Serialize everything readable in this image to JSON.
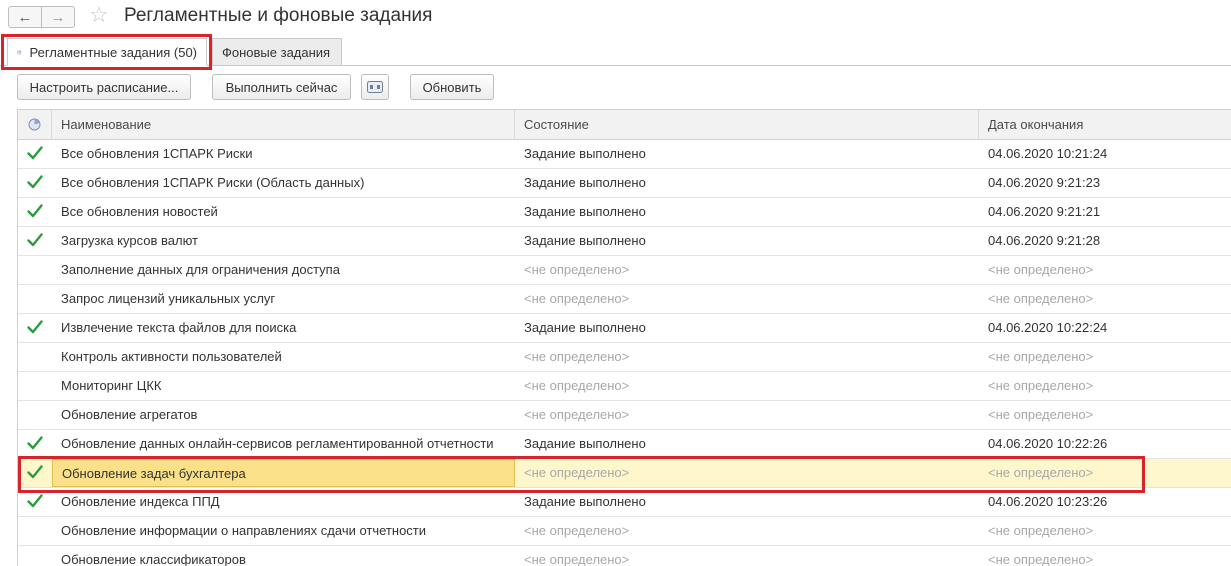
{
  "window": {
    "title": "Регламентные и фоновые задания"
  },
  "tabs": [
    {
      "label": "Регламентные задания (50)",
      "active": true
    },
    {
      "label": "Фоновые задания",
      "active": false
    }
  ],
  "toolbar": {
    "schedule_label": "Настроить расписание...",
    "run_label": "Выполнить сейчас",
    "refresh_label": "Обновить"
  },
  "grid": {
    "columns": {
      "name": "Наименование",
      "state": "Состояние",
      "date": "Дата окончания"
    },
    "rows": [
      {
        "done": true,
        "name": "Все обновления 1СПАРК Риски",
        "state": "Задание выполнено",
        "date": "04.06.2020 10:21:24"
      },
      {
        "done": true,
        "name": "Все обновления 1СПАРК Риски (Область данных)",
        "state": "Задание выполнено",
        "date": "04.06.2020 9:21:23"
      },
      {
        "done": true,
        "name": "Все обновления новостей",
        "state": "Задание выполнено",
        "date": "04.06.2020 9:21:21"
      },
      {
        "done": true,
        "name": "Загрузка курсов валют",
        "state": "Задание выполнено",
        "date": "04.06.2020 9:21:28"
      },
      {
        "done": false,
        "name": "Заполнение данных для ограничения доступа",
        "state": "<не определено>",
        "date": "<не определено>"
      },
      {
        "done": false,
        "name": "Запрос лицензий уникальных услуг",
        "state": "<не определено>",
        "date": "<не определено>"
      },
      {
        "done": true,
        "name": "Извлечение текста файлов для поиска",
        "state": "Задание выполнено",
        "date": "04.06.2020 10:22:24"
      },
      {
        "done": false,
        "name": "Контроль активности пользователей",
        "state": "<не определено>",
        "date": "<не определено>"
      },
      {
        "done": false,
        "name": "Мониторинг ЦКК",
        "state": "<не определено>",
        "date": "<не определено>"
      },
      {
        "done": false,
        "name": "Обновление агрегатов",
        "state": "<не определено>",
        "date": "<не определено>"
      },
      {
        "done": true,
        "name": "Обновление данных онлайн-сервисов регламентированной отчетности",
        "state": "Задание выполнено",
        "date": "04.06.2020 10:22:26"
      },
      {
        "done": true,
        "name": "Обновление задач бухгалтера",
        "state": "<не определено>",
        "date": "<не определено>",
        "selected": true
      },
      {
        "done": true,
        "name": "Обновление индекса ППД",
        "state": "Задание выполнено",
        "date": "04.06.2020 10:23:26"
      },
      {
        "done": false,
        "name": "Обновление информации о направлениях сдачи отчетности",
        "state": "<не определено>",
        "date": "<не определено>"
      },
      {
        "done": false,
        "name": "Обновление классификаторов",
        "state": "<не определено>",
        "date": "<не определено>"
      }
    ]
  },
  "colors": {
    "check": "#2e9b3c",
    "highlight": "#d9232a",
    "selected_row": "#fff7cc",
    "selected_cell": "#fbe08a",
    "undefined_text": "#a8a8a8"
  },
  "icons": {
    "back": "arrow-left-icon",
    "forward": "arrow-right-icon",
    "favorite": "star-icon",
    "scheduled_tab": "clock-globe-icon",
    "settings": "settings-panel-icon",
    "done": "checkmark-icon"
  }
}
